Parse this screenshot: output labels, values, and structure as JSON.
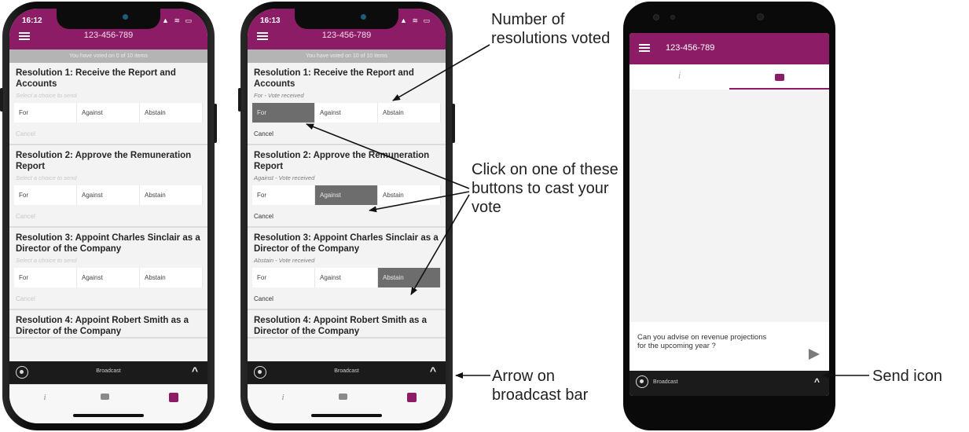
{
  "phone1": {
    "status_time": "16:12",
    "status_icons": "▲ ≋ ▭",
    "title": "123-456-789",
    "voted_text": "You have voted on 0 of 10 items",
    "resolutions": [
      {
        "title": "Resolution 1: Receive the Report and Accounts",
        "status": "Select a choice to send",
        "for": "For",
        "against": "Against",
        "abstain": "Abstain",
        "cancel": "Cancel"
      },
      {
        "title": "Resolution 2: Approve the Remuneration Report",
        "status": "Select a choice to send",
        "for": "For",
        "against": "Against",
        "abstain": "Abstain",
        "cancel": "Cancel"
      },
      {
        "title": "Resolution 3: Appoint Charles Sinclair as a Director of the Company",
        "status": "Select a choice to send",
        "for": "For",
        "against": "Against",
        "abstain": "Abstain",
        "cancel": "Cancel"
      },
      {
        "title": "Resolution 4: Appoint Robert Smith as a Director of the Company"
      }
    ],
    "broadcast_label": "Broadcast",
    "broadcast_arrow": "^",
    "nav_info": "i"
  },
  "phone2": {
    "status_time": "16:13",
    "status_icons": "▲ ≋ ▭",
    "title": "123-456-789",
    "voted_text": "You have voted on 10 of 10 items",
    "resolutions": [
      {
        "title": "Resolution 1: Receive the Report and Accounts",
        "status": "For - Vote received",
        "for": "For",
        "against": "Against",
        "abstain": "Abstain",
        "cancel": "Cancel"
      },
      {
        "title": "Resolution 2: Approve the Remuneration Report",
        "status": "Against - Vote received",
        "for": "For",
        "against": "Against",
        "abstain": "Abstain",
        "cancel": "Cancel"
      },
      {
        "title": "Resolution 3: Appoint Charles Sinclair as a Director of the Company",
        "status": "Abstain - Vote received",
        "for": "For",
        "against": "Against",
        "abstain": "Abstain",
        "cancel": "Cancel"
      },
      {
        "title": "Resolution 4: Appoint Robert Smith as a Director of the Company"
      }
    ],
    "broadcast_label": "Broadcast",
    "broadcast_arrow": "^",
    "nav_info": "i"
  },
  "phone3": {
    "title": "123-456-789",
    "tab_info": "i",
    "message": "Can you advise on revenue projections for the upcoming year ?",
    "broadcast_label": "Broadcast",
    "broadcast_arrow": "^"
  },
  "annotations": {
    "resolutions_voted": "Number of resolutions voted",
    "cast_vote": "Click on one of these buttons to cast your vote",
    "arrow_broadcast": "Arrow on broadcast bar",
    "send_icon": "Send icon"
  },
  "colors": {
    "brand": "#8d1c66",
    "selected_choice": "#6d6d6d",
    "broadcast_bar": "#1b1b1b"
  },
  "icons": [
    "menu-icon",
    "broadcast-icon",
    "info-icon",
    "chat-icon",
    "vote-icon",
    "send-icon",
    "chevron-up-icon"
  ]
}
